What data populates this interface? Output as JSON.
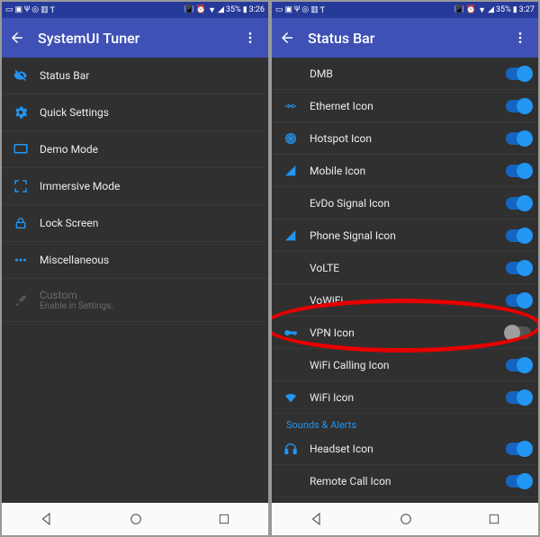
{
  "statusbar": {
    "battery_pct": "35%",
    "time_left": "3:26",
    "time_right": "3:27"
  },
  "left_screen": {
    "title": "SystemUI Tuner",
    "items": [
      {
        "icon": "visibility-off-icon",
        "label": "Status Bar"
      },
      {
        "icon": "gear-icon",
        "label": "Quick Settings"
      },
      {
        "icon": "monitor-icon",
        "label": "Demo Mode"
      },
      {
        "icon": "fullscreen-icon",
        "label": "Immersive Mode"
      },
      {
        "icon": "lock-icon",
        "label": "Lock Screen"
      },
      {
        "icon": "dots-icon",
        "label": "Miscellaneous"
      },
      {
        "icon": "brush-icon",
        "label": "Custom",
        "sublabel": "Enable in Settings.",
        "dim": true
      }
    ]
  },
  "right_screen": {
    "title": "Status Bar",
    "items": [
      {
        "icon": "",
        "label": "DMB",
        "on": true
      },
      {
        "icon": "ethernet-icon",
        "label": "Ethernet Icon",
        "on": true
      },
      {
        "icon": "hotspot-icon",
        "label": "Hotspot Icon",
        "on": true
      },
      {
        "icon": "signal-icon",
        "label": "Mobile Icon",
        "on": true
      },
      {
        "icon": "",
        "label": "EvDo Signal Icon",
        "on": true
      },
      {
        "icon": "signal-icon",
        "label": "Phone Signal Icon",
        "on": true
      },
      {
        "icon": "",
        "label": "VoLTE",
        "on": true
      },
      {
        "icon": "",
        "label": "VoWiFi",
        "on": true
      },
      {
        "icon": "vpn-key-icon",
        "label": "VPN Icon",
        "on": false
      },
      {
        "icon": "",
        "label": "WiFi Calling Icon",
        "on": true
      },
      {
        "icon": "wifi-icon",
        "label": "WiFi Icon",
        "on": true
      }
    ],
    "section2_header": "Sounds & Alerts",
    "section2_items": [
      {
        "icon": "headset-icon",
        "label": "Headset Icon",
        "on": true
      },
      {
        "icon": "",
        "label": "Remote Call Icon",
        "on": true
      }
    ]
  }
}
